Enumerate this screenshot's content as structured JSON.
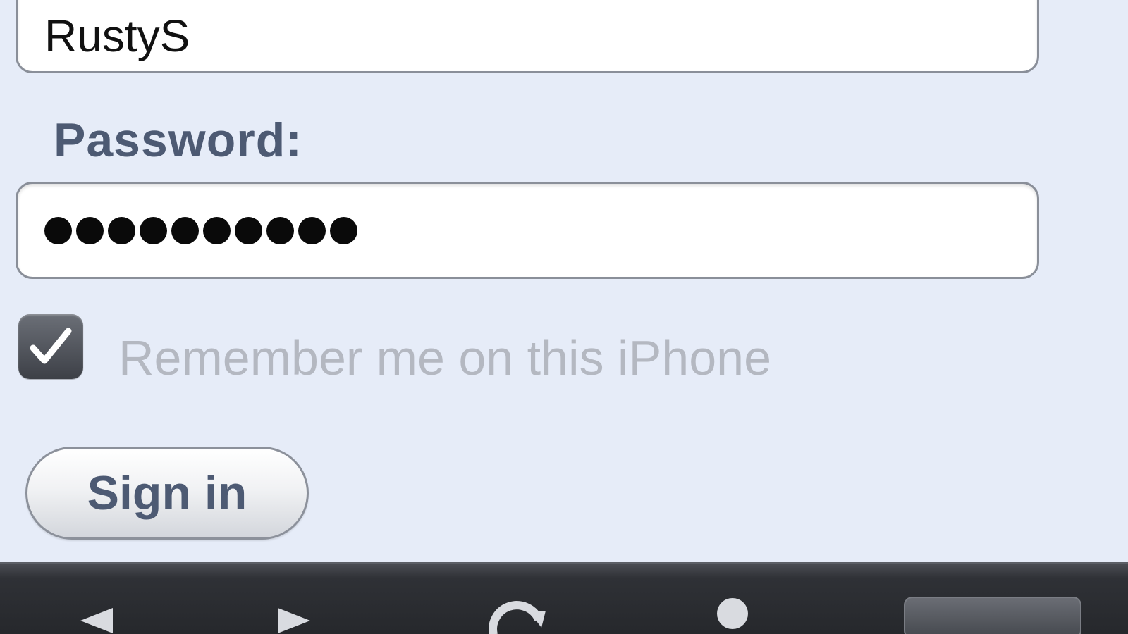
{
  "form": {
    "username_value": "RustyS",
    "password_label": "Password:",
    "password_masked": "●●●●●●●●●●",
    "remember_label": "Remember me on this iPhone",
    "remember_checked": true,
    "signin_label": "Sign in"
  },
  "toolbar": {
    "icons": [
      "back-arrow-icon",
      "forward-arrow-icon",
      "reload-icon",
      "account-icon",
      "tabs-icon"
    ]
  },
  "colors": {
    "background": "#e6ecf8",
    "label": "#4d5a73",
    "muted_text": "#b4b8c1",
    "toolbar": "#2f3136"
  }
}
